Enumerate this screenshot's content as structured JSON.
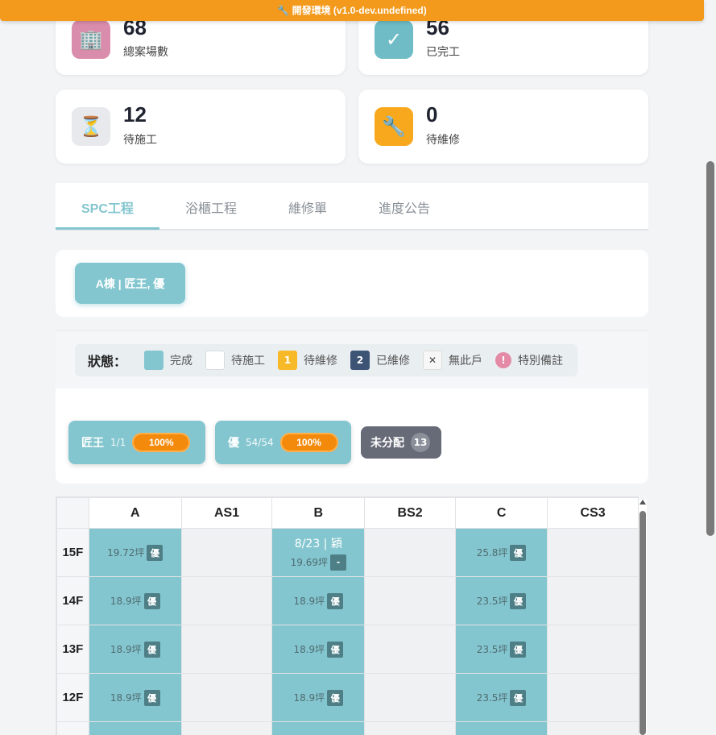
{
  "banner": {
    "text": "🔧 開發環境 (v1.0-dev.undefined)"
  },
  "stats": [
    {
      "value": "68",
      "label": "總案場數",
      "icon": "building-icon",
      "glyph": "🏢",
      "color": "#d98cab"
    },
    {
      "value": "56",
      "label": "已完工",
      "icon": "checkmark-icon",
      "glyph": "✓",
      "color": "#6fbcc6"
    },
    {
      "value": "12",
      "label": "待施工",
      "icon": "hourglass-icon",
      "glyph": "⏳",
      "color": "#e7e9ec"
    },
    {
      "value": "0",
      "label": "待維修",
      "icon": "wrench-icon",
      "glyph": "🔧",
      "color": "#f7a81c"
    }
  ],
  "tabs": [
    {
      "label": "SPC工程",
      "active": true
    },
    {
      "label": "浴櫃工程",
      "active": false
    },
    {
      "label": "維修單",
      "active": false
    },
    {
      "label": "進度公告",
      "active": false
    }
  ],
  "building_button": "A棟 | 匠王, 優",
  "legend": {
    "title": "狀態：",
    "items": [
      {
        "label": "完成",
        "symbol": "",
        "color": "#84c6cf"
      },
      {
        "label": "待施工",
        "symbol": "",
        "color": "#ffffff"
      },
      {
        "label": "待維修",
        "symbol": "1",
        "color": "#f7b928"
      },
      {
        "label": "已維修",
        "symbol": "2",
        "color": "#3d5474"
      },
      {
        "label": "無此戶",
        "symbol": "✕",
        "color": "#f5f5f5"
      },
      {
        "label": "特別備註",
        "symbol": "!",
        "color": "#e58aa6"
      }
    ]
  },
  "workers": [
    {
      "name": "匠王",
      "count": "1/1",
      "percent": "100%",
      "progress": 1.0
    },
    {
      "name": "優",
      "count": "54/54",
      "percent": "100%",
      "progress": 1.0
    }
  ],
  "unassigned": {
    "label": "未分配",
    "count": "13"
  },
  "grid": {
    "columns": [
      "A",
      "AS1",
      "B",
      "BS2",
      "C",
      "CS3"
    ],
    "rows": [
      {
        "floor": "15F",
        "cells": [
          {
            "status": "done",
            "size": "19.72坪",
            "tag": "優"
          },
          {
            "status": "empty"
          },
          {
            "status": "done",
            "top": "8/23 | 穎",
            "size": "19.69坪",
            "tag": "-"
          },
          {
            "status": "empty"
          },
          {
            "status": "done",
            "size": "25.8坪",
            "tag": "優"
          },
          {
            "status": "empty"
          }
        ]
      },
      {
        "floor": "14F",
        "cells": [
          {
            "status": "done",
            "size": "18.9坪",
            "tag": "優"
          },
          {
            "status": "empty"
          },
          {
            "status": "done",
            "size": "18.9坪",
            "tag": "優"
          },
          {
            "status": "empty"
          },
          {
            "status": "done",
            "size": "23.5坪",
            "tag": "優"
          },
          {
            "status": "empty"
          }
        ]
      },
      {
        "floor": "13F",
        "cells": [
          {
            "status": "done",
            "size": "18.9坪",
            "tag": "優"
          },
          {
            "status": "empty"
          },
          {
            "status": "done",
            "size": "18.9坪",
            "tag": "優"
          },
          {
            "status": "empty"
          },
          {
            "status": "done",
            "size": "23.5坪",
            "tag": "優"
          },
          {
            "status": "empty"
          }
        ]
      },
      {
        "floor": "12F",
        "cells": [
          {
            "status": "done",
            "size": "18.9坪",
            "tag": "優"
          },
          {
            "status": "empty"
          },
          {
            "status": "done",
            "size": "18.9坪",
            "tag": "優"
          },
          {
            "status": "empty"
          },
          {
            "status": "done",
            "size": "23.5坪",
            "tag": "優"
          },
          {
            "status": "empty"
          }
        ]
      },
      {
        "floor": "",
        "cells": [
          {
            "status": "done"
          },
          {
            "status": "empty"
          },
          {
            "status": "done"
          },
          {
            "status": "empty"
          },
          {
            "status": "done"
          },
          {
            "status": "empty"
          }
        ]
      }
    ]
  }
}
